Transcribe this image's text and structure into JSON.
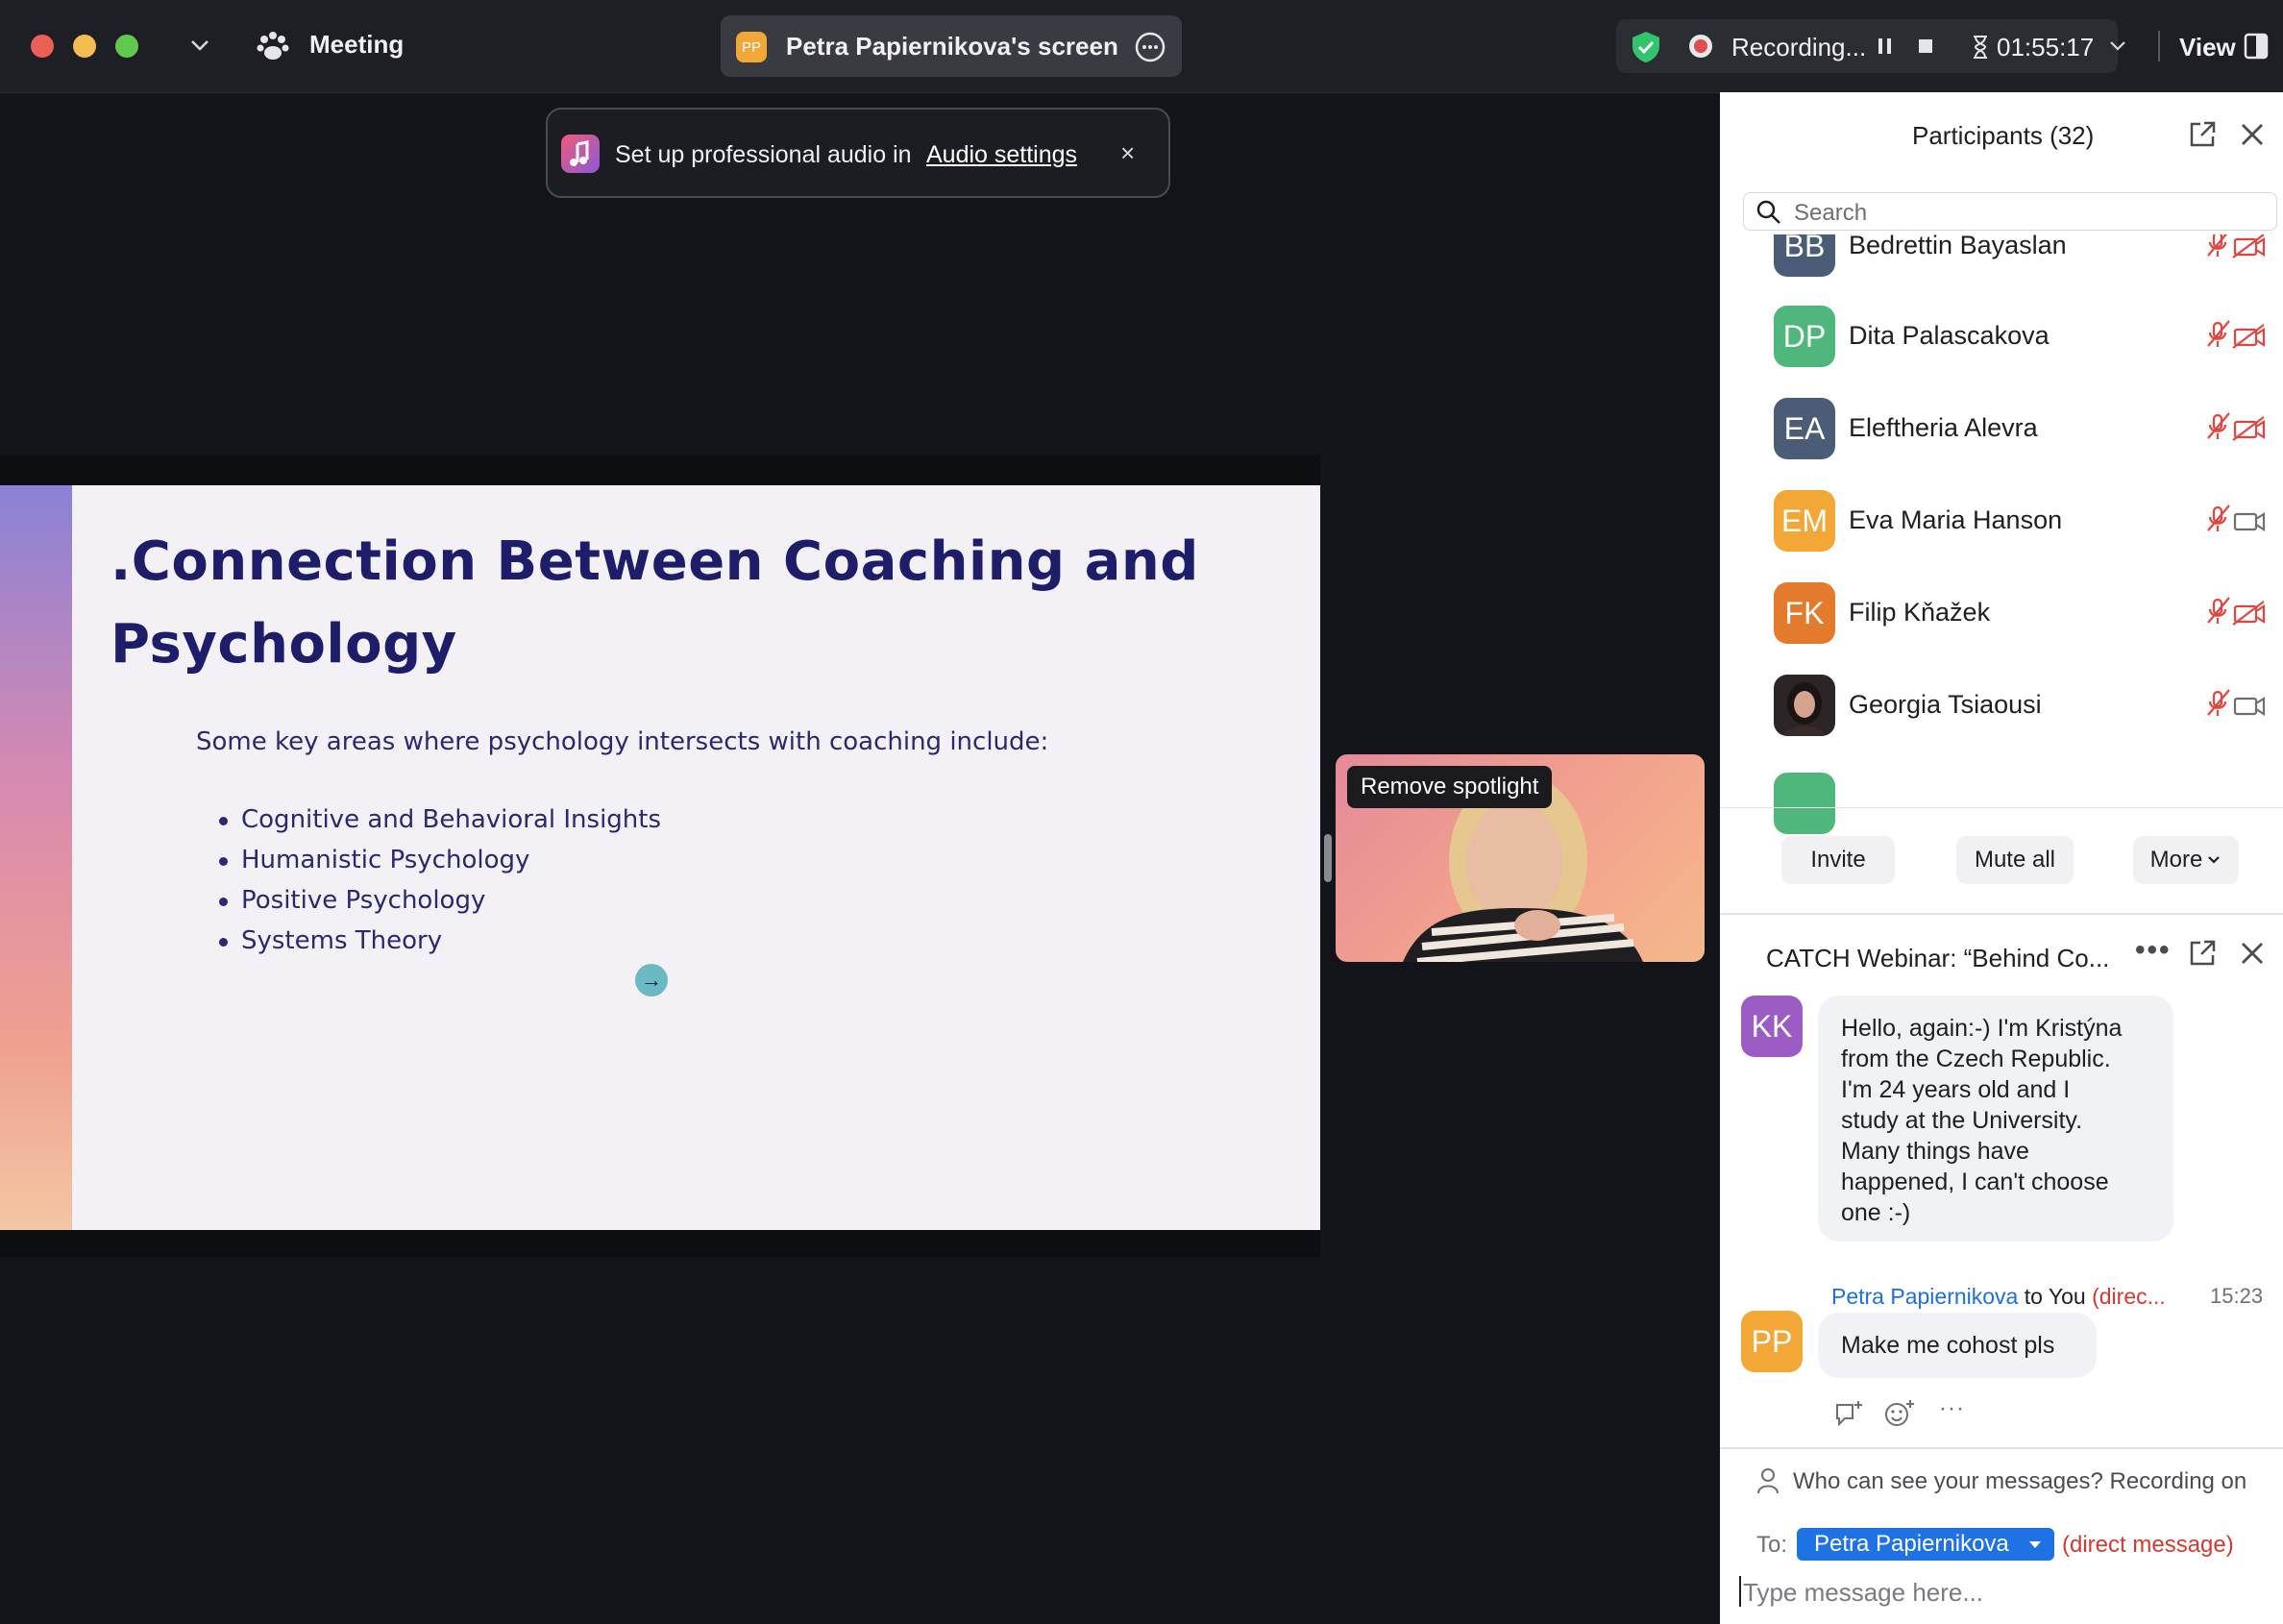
{
  "topbar": {
    "meeting_label": "Meeting",
    "share_title": "Petra Papiernikova's screen",
    "share_avatar": "PP",
    "recording_label": "Recording...",
    "timer": "01:55:17",
    "view_label": "View",
    "icons": [
      "paw-icon",
      "chevron-down-icon",
      "more-icon",
      "shield-icon",
      "record-icon",
      "pause-icon",
      "stop-icon",
      "hourglass-icon",
      "view-icon"
    ],
    "colors": {
      "close": "#ec5f55",
      "minimize": "#f4bd4f",
      "maximize": "#5fc84d",
      "shield": "#2fc46d",
      "pill_avatar": "#f2a736"
    }
  },
  "toast": {
    "text": "Set up professional audio in",
    "link": "Audio settings",
    "close": "×"
  },
  "slide": {
    "title_line1": ".Connection Between Coaching and",
    "title_line2": "Psychology",
    "intro": "Some key areas where psychology intersects with coaching include:",
    "bullets": [
      "Cognitive and Behavioral Insights",
      "Humanistic Psychology",
      "Positive Psychology",
      "Systems Theory"
    ],
    "arrow": "→"
  },
  "video": {
    "spotlight_label": "Remove spotlight"
  },
  "participants": {
    "title": "Participants (32)",
    "search_placeholder": "Search",
    "list": [
      {
        "initials": "BB",
        "name": "Bedrettin Bayaslan",
        "color": "#4b5d76",
        "video_icon": "video-off-icon"
      },
      {
        "initials": "DP",
        "name": "Dita Palascakova",
        "color": "#4fb77b",
        "video_icon": "video-off-icon"
      },
      {
        "initials": "EA",
        "name": "Eleftheria Alevra",
        "color": "#4b5d76",
        "video_icon": "video-off-icon"
      },
      {
        "initials": "EM",
        "name": "Eva Maria Hanson",
        "color": "#f2a736",
        "video_icon": "video-icon"
      },
      {
        "initials": "FK",
        "name": "Filip Kňažek",
        "color": "#e47a2c",
        "video_icon": "video-off-icon"
      },
      {
        "initials": "",
        "name": "Georgia Tsiaousi",
        "color": "#2b2526",
        "video_icon": "video-icon"
      }
    ],
    "buttons": {
      "invite": "Invite",
      "mute_all": "Mute all",
      "more": "More"
    }
  },
  "chat": {
    "title": "CATCH Webinar: “Behind Co...",
    "messages": [
      {
        "initials": "KK",
        "color": "#9b5cc4",
        "text_lines": [
          "Hello, again:-) I'm Kristýna",
          "from the Czech Republic.",
          "I'm 24 years old and I",
          "study at the University.",
          "Many things have",
          "happened, I can't choose",
          "one :-)"
        ]
      },
      {
        "initials": "PP",
        "color": "#f2a736",
        "sender": "Petra Papiernikova",
        "to": "to You",
        "direct": "(direc...",
        "time": "15:23",
        "text": "Make me cohost pls"
      }
    ],
    "privacy_note": "Who can see your messages? Recording on",
    "to_label": "To:",
    "recipient": "Petra Papiernikova",
    "direct_message": "(direct message)",
    "input_placeholder": "Type message here...",
    "accent": "#1e72e3"
  }
}
